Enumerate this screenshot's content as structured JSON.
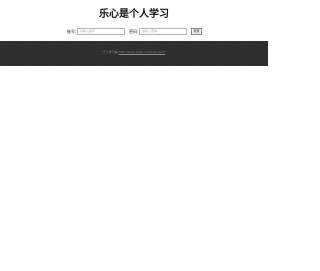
{
  "header": {
    "title": "乐心是个人学习"
  },
  "login": {
    "account_label": "账号:",
    "account_placeholder": "请输入账号",
    "password_label": "密码:",
    "password_placeholder": "请输入密码",
    "login_button": "登录"
  },
  "footer": {
    "text": "个人学习站",
    "link_text": "http://blog.xxxx.com/xxx-xxx.x"
  }
}
